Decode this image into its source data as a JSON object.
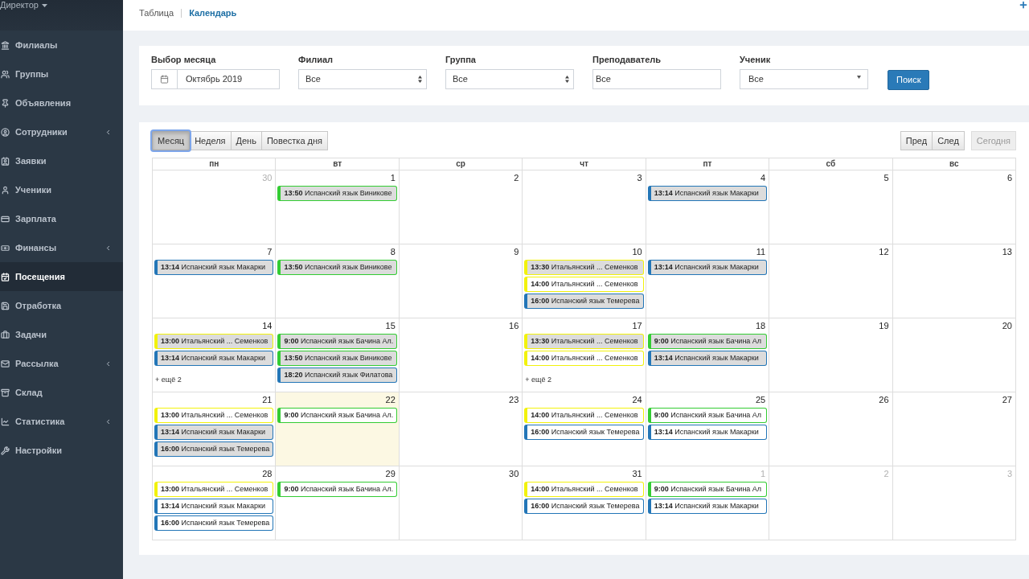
{
  "sidebar": {
    "user_menu": "Директор",
    "items": [
      {
        "label": "Филиалы",
        "selected": false,
        "has_submenu": false
      },
      {
        "label": "Группы",
        "selected": false,
        "has_submenu": false
      },
      {
        "label": "Объявления",
        "selected": false,
        "has_submenu": false
      },
      {
        "label": "Сотрудники",
        "selected": false,
        "has_submenu": true
      },
      {
        "label": "Заявки",
        "selected": false,
        "has_submenu": false
      },
      {
        "label": "Ученики",
        "selected": false,
        "has_submenu": false
      },
      {
        "label": "Зарплата",
        "selected": false,
        "has_submenu": false
      },
      {
        "label": "Финансы",
        "selected": false,
        "has_submenu": true
      },
      {
        "label": "Посещения",
        "selected": true,
        "has_submenu": false
      },
      {
        "label": "Отработка",
        "selected": false,
        "has_submenu": false
      },
      {
        "label": "Задачи",
        "selected": false,
        "has_submenu": false
      },
      {
        "label": "Рассылка",
        "selected": false,
        "has_submenu": true
      },
      {
        "label": "Склад",
        "selected": false,
        "has_submenu": false
      },
      {
        "label": "Статистика",
        "selected": false,
        "has_submenu": true
      },
      {
        "label": "Настройки",
        "selected": false,
        "has_submenu": false
      }
    ]
  },
  "top_tabs": [
    {
      "label": "Таблица",
      "selected": false
    },
    {
      "label": "Календарь",
      "selected": true
    }
  ],
  "filters": {
    "fields": [
      {
        "kind": "date",
        "label": "Выбор месяца",
        "value": "Октябрь 2019"
      },
      {
        "kind": "select",
        "label": "Филиал",
        "value": "Все"
      },
      {
        "kind": "select",
        "label": "Группа",
        "value": "Все"
      },
      {
        "kind": "text",
        "label": "Преподаватель",
        "value": "Все"
      },
      {
        "kind": "dropdown",
        "label": "Ученик",
        "value": "Все"
      }
    ],
    "search_button": "Поиск"
  },
  "calendar": {
    "view_buttons": [
      {
        "label": "Месяц",
        "selected": true
      },
      {
        "label": "Неделя",
        "selected": false
      },
      {
        "label": "День",
        "selected": false
      },
      {
        "label": "Повестка дня",
        "selected": false
      }
    ],
    "nav_buttons": [
      {
        "label": "Пред",
        "disabled": false
      },
      {
        "label": "След",
        "disabled": false
      },
      {
        "label": "Сегодня",
        "disabled": true
      }
    ],
    "weekdays": [
      "пн",
      "вт",
      "ср",
      "чт",
      "пт",
      "сб",
      "вс"
    ],
    "weeks": [
      {
        "days": [
          {
            "number": "30",
            "other_month": true,
            "today": false
          },
          {
            "number": "1",
            "other_month": false,
            "today": false,
            "events": [
              {
                "time": "13:50",
                "title": "Испанский язык Виникове",
                "color": "#33cc33",
                "shaded": true
              }
            ]
          },
          {
            "number": "2",
            "other_month": false,
            "today": false
          },
          {
            "number": "3",
            "other_month": false,
            "today": false
          },
          {
            "number": "4",
            "other_month": false,
            "today": false,
            "events": [
              {
                "time": "13:14",
                "title": "Испанский язык Макарки",
                "color": "#2376b7",
                "shaded": true
              }
            ]
          },
          {
            "number": "5",
            "other_month": false,
            "today": false
          },
          {
            "number": "6",
            "other_month": false,
            "today": false
          }
        ]
      },
      {
        "days": [
          {
            "number": "7",
            "other_month": false,
            "today": false,
            "events": [
              {
                "time": "13:14",
                "title": "Испанский язык Макарки",
                "color": "#2376b7",
                "shaded": true
              }
            ]
          },
          {
            "number": "8",
            "other_month": false,
            "today": false,
            "events": [
              {
                "time": "13:50",
                "title": "Испанский язык Виникове",
                "color": "#33cc33",
                "shaded": true
              }
            ]
          },
          {
            "number": "9",
            "other_month": false,
            "today": false
          },
          {
            "number": "10",
            "other_month": false,
            "today": false,
            "events": [
              {
                "time": "13:30",
                "title": "Итальянский ... Семенков",
                "color": "#f2f20c",
                "shaded": true
              },
              {
                "time": "14:00",
                "title": "Итальянский ... Семенков",
                "color": "#f2f20c",
                "shaded": false
              },
              {
                "time": "16:00",
                "title": "Испанский язык Темерева",
                "color": "#2376b7",
                "shaded": true
              }
            ]
          },
          {
            "number": "11",
            "other_month": false,
            "today": false,
            "events": [
              {
                "time": "13:14",
                "title": "Испанский язык Макарки",
                "color": "#2376b7",
                "shaded": true
              }
            ]
          },
          {
            "number": "12",
            "other_month": false,
            "today": false
          },
          {
            "number": "13",
            "other_month": false,
            "today": false
          }
        ]
      },
      {
        "days": [
          {
            "number": "14",
            "other_month": false,
            "today": false,
            "events": [
              {
                "time": "13:00",
                "title": "Итальянский ... Семенков",
                "color": "#f2f20c",
                "shaded": true
              },
              {
                "time": "13:14",
                "title": "Испанский язык Макарки",
                "color": "#2376b7",
                "shaded": true
              }
            ],
            "more": "+ ещё 2"
          },
          {
            "number": "15",
            "other_month": false,
            "today": false,
            "events": [
              {
                "time": "9:00",
                "title": "Испанский язык Бачина Ал.",
                "color": "#33cc33",
                "shaded": true
              },
              {
                "time": "13:50",
                "title": "Испанский язык Виникове",
                "color": "#33cc33",
                "shaded": true
              },
              {
                "time": "18:20",
                "title": "Испанский язык Филатова",
                "color": "#2376b7",
                "shaded": true
              }
            ]
          },
          {
            "number": "16",
            "other_month": false,
            "today": false
          },
          {
            "number": "17",
            "other_month": false,
            "today": false,
            "events": [
              {
                "time": "13:30",
                "title": "Итальянский ... Семенков",
                "color": "#f2f20c",
                "shaded": true
              },
              {
                "time": "14:00",
                "title": "Итальянский ... Семенков",
                "color": "#f2f20c",
                "shaded": false
              }
            ],
            "more": "+ ещё 2"
          },
          {
            "number": "18",
            "other_month": false,
            "today": false,
            "events": [
              {
                "time": "9:00",
                "title": "Испанский язык Бачина Ал",
                "color": "#33cc33",
                "shaded": true
              },
              {
                "time": "13:14",
                "title": "Испанский язык Макарки",
                "color": "#2376b7",
                "shaded": true
              }
            ]
          },
          {
            "number": "19",
            "other_month": false,
            "today": false
          },
          {
            "number": "20",
            "other_month": false,
            "today": false
          }
        ]
      },
      {
        "days": [
          {
            "number": "21",
            "other_month": false,
            "today": false,
            "events": [
              {
                "time": "13:00",
                "title": "Итальянский ... Семенков",
                "color": "#f2f20c",
                "shaded": false
              },
              {
                "time": "13:14",
                "title": "Испанский язык Макарки",
                "color": "#2376b7",
                "shaded": true
              },
              {
                "time": "16:00",
                "title": "Испанский язык Темерева",
                "color": "#2376b7",
                "shaded": true
              }
            ]
          },
          {
            "number": "22",
            "other_month": false,
            "today": true,
            "events": [
              {
                "time": "9:00",
                "title": "Испанский язык Бачина Ал.",
                "color": "#33cc33",
                "shaded": false
              }
            ]
          },
          {
            "number": "23",
            "other_month": false,
            "today": false
          },
          {
            "number": "24",
            "other_month": false,
            "today": false,
            "events": [
              {
                "time": "14:00",
                "title": "Итальянский ... Семенков",
                "color": "#f2f20c",
                "shaded": false
              },
              {
                "time": "16:00",
                "title": "Испанский язык Темерева",
                "color": "#2376b7",
                "shaded": false
              }
            ]
          },
          {
            "number": "25",
            "other_month": false,
            "today": false,
            "events": [
              {
                "time": "9:00",
                "title": "Испанский язык Бачина Ал",
                "color": "#33cc33",
                "shaded": false
              },
              {
                "time": "13:14",
                "title": "Испанский язык Макарки",
                "color": "#2376b7",
                "shaded": false
              }
            ]
          },
          {
            "number": "26",
            "other_month": false,
            "today": false
          },
          {
            "number": "27",
            "other_month": false,
            "today": false
          }
        ]
      },
      {
        "days": [
          {
            "number": "28",
            "other_month": false,
            "today": false,
            "events": [
              {
                "time": "13:00",
                "title": "Итальянский ... Семенков",
                "color": "#f2f20c",
                "shaded": false
              },
              {
                "time": "13:14",
                "title": "Испанский язык Макарки",
                "color": "#2376b7",
                "shaded": false
              },
              {
                "time": "16:00",
                "title": "Испанский язык Темерева",
                "color": "#2376b7",
                "shaded": false
              }
            ]
          },
          {
            "number": "29",
            "other_month": false,
            "today": false,
            "events": [
              {
                "time": "9:00",
                "title": "Испанский язык Бачина Ал.",
                "color": "#33cc33",
                "shaded": false
              }
            ]
          },
          {
            "number": "30",
            "other_month": false,
            "today": false
          },
          {
            "number": "31",
            "other_month": false,
            "today": false,
            "events": [
              {
                "time": "14:00",
                "title": "Итальянский ... Семенков",
                "color": "#f2f20c",
                "shaded": false
              },
              {
                "time": "16:00",
                "title": "Испанский язык Темерева",
                "color": "#2376b7",
                "shaded": false
              }
            ]
          },
          {
            "number": "1",
            "other_month": true,
            "today": false,
            "events": [
              {
                "time": "9:00",
                "title": "Испанский язык Бачина Ал",
                "color": "#33cc33",
                "shaded": false
              },
              {
                "time": "13:14",
                "title": "Испанский язык Макарки",
                "color": "#2376b7",
                "shaded": false
              }
            ]
          },
          {
            "number": "2",
            "other_month": true,
            "today": false
          },
          {
            "number": "3",
            "other_month": true,
            "today": false
          }
        ]
      }
    ]
  }
}
